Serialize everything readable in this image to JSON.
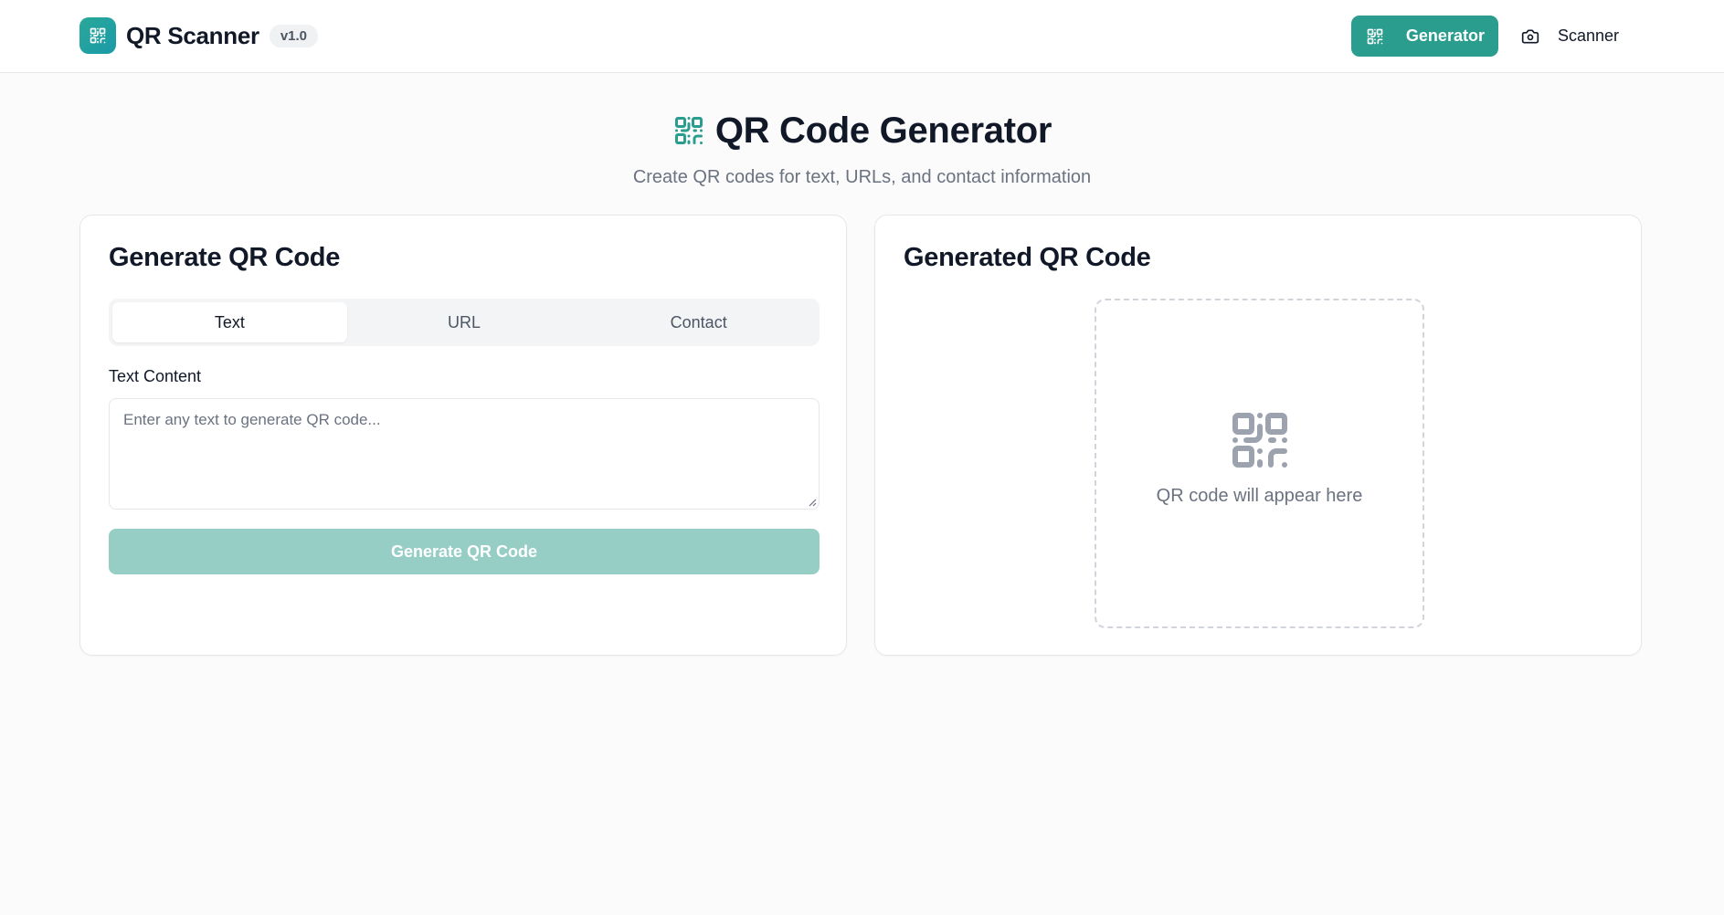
{
  "header": {
    "brand_title": "QR Scanner",
    "version": "v1.0",
    "nav": {
      "generator_label": "Generator",
      "scanner_label": "Scanner"
    }
  },
  "hero": {
    "title": "QR Code Generator",
    "subtitle": "Create QR codes for text, URLs, and contact information"
  },
  "generate_card": {
    "title": "Generate QR Code",
    "tabs": [
      {
        "label": "Text",
        "active": true
      },
      {
        "label": "URL",
        "active": false
      },
      {
        "label": "Contact",
        "active": false
      }
    ],
    "field_label": "Text Content",
    "textarea_value": "",
    "textarea_placeholder": "Enter any text to generate QR code...",
    "button_label": "Generate QR Code",
    "button_disabled": true
  },
  "result_card": {
    "title": "Generated QR Code",
    "placeholder_text": "QR code will appear here"
  },
  "icons": {
    "brand": "qr-code-icon",
    "generator": "qr-code-icon",
    "scanner": "camera-icon",
    "hero": "qr-code-icon",
    "placeholder": "qr-code-icon"
  },
  "colors": {
    "accent": "#2a9d8f",
    "accent_disabled": "#96cec6",
    "placeholder_icon": "#9ca3af",
    "text_primary": "#111827",
    "text_muted": "#6b7280"
  }
}
